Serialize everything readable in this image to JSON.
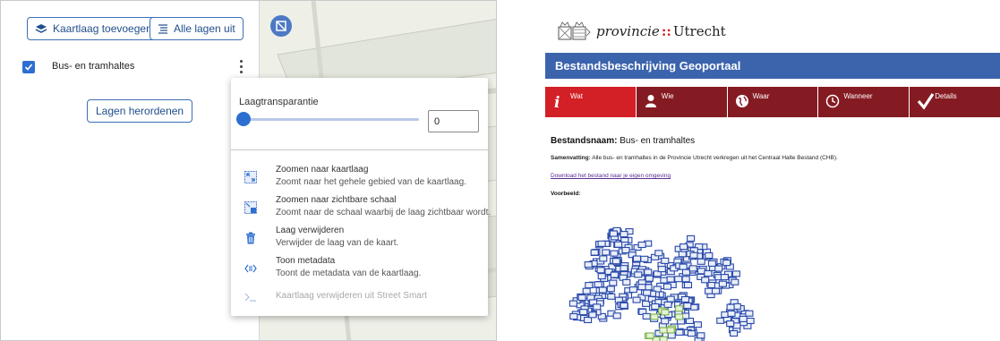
{
  "layer_panel": {
    "add_layer_label": "Kaartlaag toevoegen",
    "all_off_label": "Alle lagen uit",
    "layer_name": "Bus- en tramhaltes",
    "reorder_label": "Lagen herordenen"
  },
  "layer_menu": {
    "transparency_label": "Laagtransparantie",
    "transparency_value": "0",
    "transparency_level": 0,
    "items": [
      {
        "title": "Zoomen naar kaartlaag",
        "desc": "Zoomt naar het gehele gebied van de kaartlaag.",
        "icon": "zoom-extent-icon",
        "enabled": true
      },
      {
        "title": "Zoomen naar zichtbare schaal",
        "desc": "Zoomt naar de schaal waarbij de laag zichtbaar wordt.",
        "icon": "zoom-scale-icon",
        "enabled": true
      },
      {
        "title": "Laag verwijderen",
        "desc": "Verwijder de laag van de kaart.",
        "icon": "trash-icon",
        "enabled": true
      },
      {
        "title": "Toon metadata",
        "desc": "Toont de metadata van de kaartlaag.",
        "icon": "metadata-icon",
        "enabled": true
      },
      {
        "title": "Kaartlaag verwijderen uit Street Smart",
        "desc": "",
        "icon": "terminal-icon",
        "enabled": false
      }
    ]
  },
  "metadata_page": {
    "logo_word1": "provincie",
    "logo_sep": "::",
    "logo_word2": "Utrecht",
    "banner_title": "Bestandsbeschrijving Geoportaal",
    "tabs": [
      {
        "label": "Wat",
        "icon": "info-icon",
        "active": true
      },
      {
        "label": "Wie",
        "icon": "person-icon",
        "active": false
      },
      {
        "label": "Waar",
        "icon": "globe-icon",
        "active": false
      },
      {
        "label": "Wanneer",
        "icon": "clock-icon",
        "active": false
      },
      {
        "label": "Details",
        "icon": "checkmark-icon",
        "active": false
      }
    ],
    "name_label": "Bestandsnaam:",
    "name_value": "Bus- en tramhaltes",
    "summary_label": "Samenvatting:",
    "summary_value": "Alle bus- en tramhaltes in de Provincie Utrecht verkregen uit het Centraal Halte Bestand (CHB).",
    "download_link": "Download het bestand naar je eigen omgeving",
    "preview_label": "Voorbeeld:"
  },
  "colors": {
    "accent_blue": "#2d6fd1",
    "banner_blue": "#3c64ad",
    "tab_dark_red": "#851b22",
    "tab_active_red": "#d31f26"
  }
}
